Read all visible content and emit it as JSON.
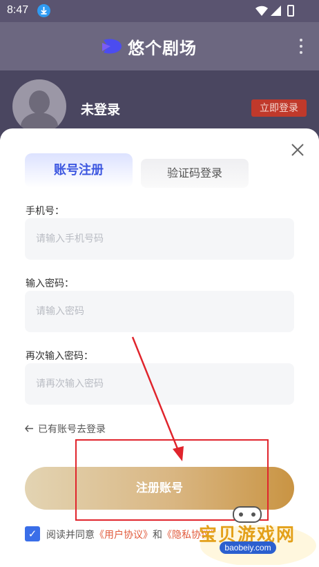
{
  "status_bar": {
    "time": "8:47"
  },
  "app_bar": {
    "title": "悠个剧场"
  },
  "profile": {
    "status_text": "未登录",
    "login_button": "立即登录"
  },
  "tabs": [
    {
      "label": "账号注册",
      "active": true
    },
    {
      "label": "验证码登录",
      "active": false
    }
  ],
  "form": {
    "phone": {
      "label": "手机号：",
      "placeholder": "请输入手机号码",
      "value": ""
    },
    "password": {
      "label": "输入密码：",
      "placeholder": "请输入密码",
      "value": ""
    },
    "confirm_password": {
      "label": "再次输入密码：",
      "placeholder": "请再次输入密码",
      "value": ""
    }
  },
  "back_to_login": "已有账号去登录",
  "register_button": "注册账号",
  "agreement": {
    "checked": true,
    "prefix": "阅读并同意",
    "user_agreement": "《用户协议》",
    "and": "和",
    "privacy_policy": "《隐私协议》"
  },
  "watermark": {
    "text": "宝贝游戏网",
    "url": "baobeiy.com"
  },
  "colors": {
    "accent_blue": "#3d57e0",
    "register_gold": "#c99443",
    "login_red": "#c0392b",
    "link_orange": "#e15a3b",
    "annotation_red": "#e0242c"
  },
  "icons": [
    "download-icon",
    "wifi-icon",
    "signal-icon",
    "battery-icon",
    "logo-icon",
    "more-vert-icon",
    "close-icon",
    "arrow-left-icon",
    "checkbox-checked-icon",
    "arrow-annotation"
  ]
}
